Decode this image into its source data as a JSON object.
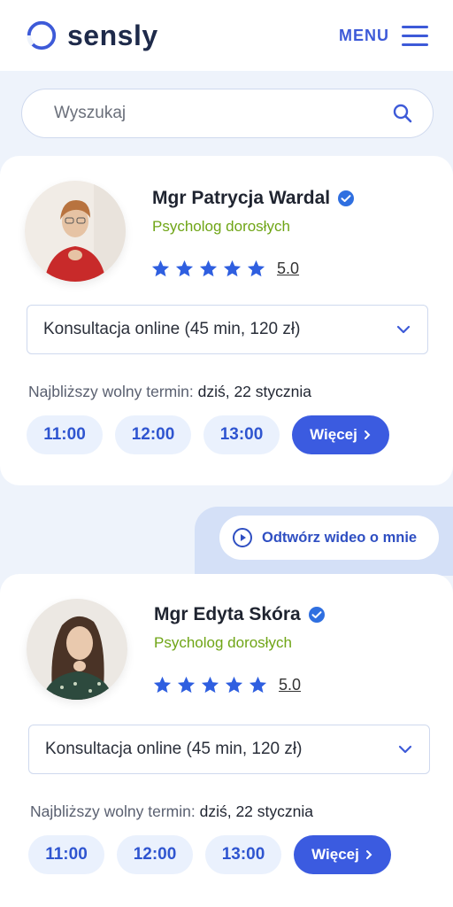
{
  "header": {
    "brand": "sensly",
    "menu_label": "MENU"
  },
  "search": {
    "placeholder": "Wyszukaj"
  },
  "video_button": {
    "label": "Odtwórz wideo o mnie"
  },
  "colors": {
    "accent": "#3b5be0",
    "specialty": "#6fa516",
    "slot_bg": "#eaf1fd",
    "page_bg": "#eef3fb"
  },
  "therapists": [
    {
      "name": "Mgr Patrycja Wardal",
      "specialty": "Psycholog dorosłych",
      "rating": "5.0",
      "stars": 5,
      "consultation": "Konsultacja online (45 min, 120 zł)",
      "next_term_label": "Najbliższy wolny termin:",
      "next_term_value": "dziś, 22 stycznia",
      "slots": [
        "11:00",
        "12:00",
        "13:00"
      ],
      "more_label": "Więcej"
    },
    {
      "name": "Mgr Edyta Skóra",
      "specialty": "Psycholog dorosłych",
      "rating": "5.0",
      "stars": 5,
      "consultation": "Konsultacja online (45 min, 120 zł)",
      "next_term_label": "Najbliższy wolny termin:",
      "next_term_value": "dziś, 22 stycznia",
      "slots": [
        "11:00",
        "12:00",
        "13:00"
      ],
      "more_label": "Więcej"
    }
  ]
}
